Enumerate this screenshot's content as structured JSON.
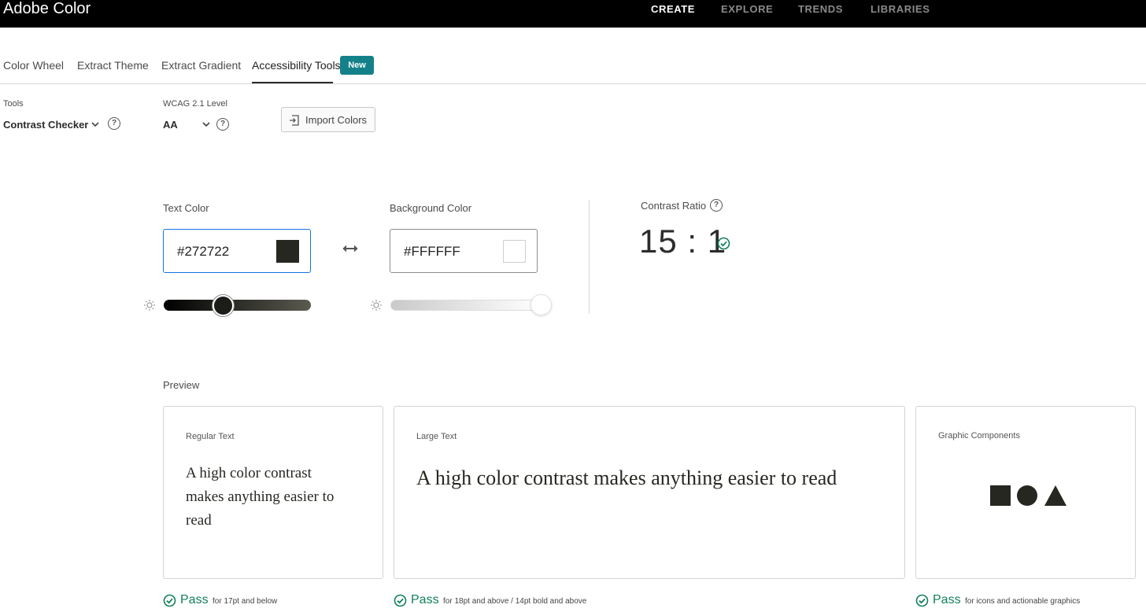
{
  "app": {
    "title": "Adobe Color"
  },
  "topnav": {
    "create": "CREATE",
    "explore": "EXPLORE",
    "trends": "TRENDS",
    "libraries": "LIBRARIES"
  },
  "tabs": {
    "color_wheel": "Color Wheel",
    "extract_theme": "Extract Theme",
    "extract_gradient": "Extract Gradient",
    "accessibility_tools": "Accessibility Tools",
    "badge": "New"
  },
  "toolbar": {
    "tools_label": "Tools",
    "tools_value": "Contrast Checker",
    "wcag_label": "WCAG 2.1 Level",
    "wcag_value": "AA",
    "import_label": "Import Colors"
  },
  "text_color": {
    "label": "Text Color",
    "value": "#272722",
    "slider_fraction": 0.41
  },
  "background_color": {
    "label": "Background Color",
    "value": "#FFFFFF",
    "slider_fraction": 1.0
  },
  "contrast": {
    "label": "Contrast Ratio",
    "value": "15 : 1"
  },
  "preview": {
    "label": "Preview",
    "regular": {
      "title": "Regular Text",
      "sample": "A high color contrast makes anything easier to read",
      "result": "Pass",
      "note": "for 17pt and below"
    },
    "large": {
      "title": "Large Text",
      "sample": "A high color contrast makes anything easier to read",
      "result": "Pass",
      "note": "for 18pt and above / 14pt bold and above"
    },
    "graphic": {
      "title": "Graphic Components",
      "result": "Pass",
      "note": "for icons and actionable graphics"
    }
  },
  "colors": {
    "pass_green": "#12805c",
    "badge_teal": "#14818a",
    "focus_blue": "#1473e6"
  }
}
